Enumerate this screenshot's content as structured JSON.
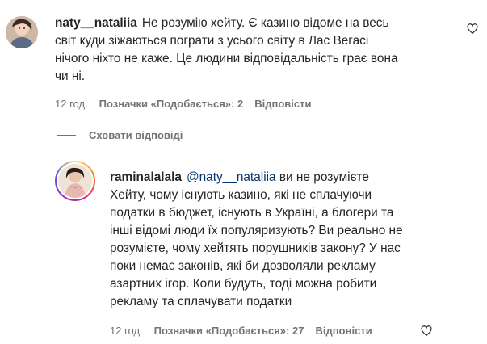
{
  "comment1": {
    "username": "naty__nataliia",
    "text_lines": [
      "Не розумію хейту. Є казино відоме на весь",
      "світ куди зіжаються пограти з усього світу в Лас Вегасі",
      "нічого ніхто не каже. Це людини відповідальність грає вона",
      "чи ні."
    ],
    "time": "12 год.",
    "likes": "Позначки «Подобається»: 2",
    "reply_label": "Відповісти"
  },
  "hide_replies": "Сховати відповіді",
  "reply1": {
    "username": "raminalalala",
    "mention": "@naty__nataliia",
    "text_first": " ви не розумієте",
    "text_lines": [
      "Хейту, чому існують казино, які не сплачуючи",
      "податки в бюджет, існують в Україні, а блогери та",
      "інші відомі люди їх популяризують? Ви реально не",
      "розумієте, чому хейтять порушників закону? У нас",
      "поки немає законів, які би дозволяли рекламу",
      "азартних ігор. Коли будуть, тоді можна робити",
      "рекламу та сплачувати податки"
    ],
    "time": "12 год.",
    "likes": "Позначки «Подобається»: 27",
    "reply_label": "Відповісти"
  }
}
